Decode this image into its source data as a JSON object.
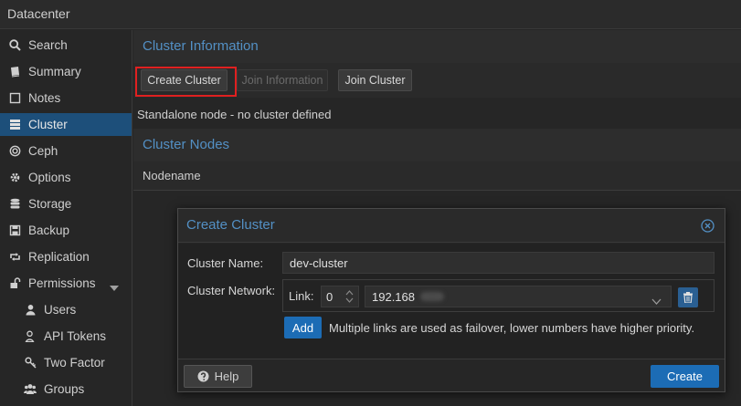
{
  "header": {
    "title": "Datacenter"
  },
  "sidebar": {
    "items": [
      {
        "label": "Search",
        "icon": "search-icon"
      },
      {
        "label": "Summary",
        "icon": "book-icon"
      },
      {
        "label": "Notes",
        "icon": "note-icon"
      },
      {
        "label": "Cluster",
        "icon": "server-icon",
        "active": true
      },
      {
        "label": "Ceph",
        "icon": "ceph-icon"
      },
      {
        "label": "Options",
        "icon": "gear-icon"
      },
      {
        "label": "Storage",
        "icon": "database-icon"
      },
      {
        "label": "Backup",
        "icon": "floppy-icon"
      },
      {
        "label": "Replication",
        "icon": "retweet-icon"
      },
      {
        "label": "Permissions",
        "icon": "unlock-icon"
      },
      {
        "label": "Users",
        "icon": "user-icon"
      },
      {
        "label": "API Tokens",
        "icon": "user-key-icon"
      },
      {
        "label": "Two Factor",
        "icon": "key-icon"
      },
      {
        "label": "Groups",
        "icon": "users-icon"
      }
    ]
  },
  "main": {
    "cluster_info_title": "Cluster Information",
    "toolbar": {
      "create_cluster": "Create Cluster",
      "join_information": "Join Information",
      "join_cluster": "Join Cluster"
    },
    "status_text": "Standalone node - no cluster defined",
    "nodes_title": "Cluster Nodes",
    "nodes_column": "Nodename"
  },
  "dialog": {
    "title": "Create Cluster",
    "cluster_name_label": "Cluster Name:",
    "cluster_name_value": "dev-cluster",
    "cluster_network_label": "Cluster Network:",
    "link_label": "Link:",
    "link_number": "0",
    "link_address": "192.168",
    "add_label": "Add",
    "hint": "Multiple links are used as failover, lower numbers have higher priority.",
    "help_label": "Help",
    "create_label": "Create"
  },
  "colors": {
    "accent": "#5390c5",
    "primary_button": "#1c6cb5",
    "active_nav": "#1d4f7a",
    "highlight_box": "#e02020"
  }
}
